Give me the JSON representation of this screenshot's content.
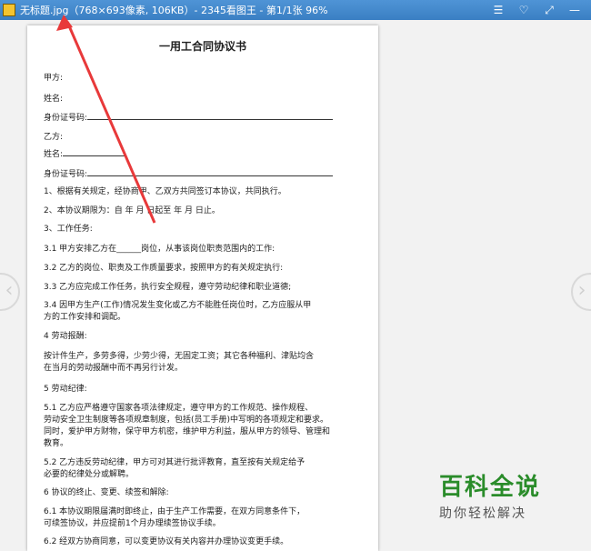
{
  "titlebar": {
    "title": "无标题.jpg（768×693像素, 106KB）- 2345看图王 - 第1/1张 96%",
    "icons": [
      "menu-icon",
      "skin-icon",
      "fullscreen-icon",
      "minimize-icon"
    ]
  },
  "document": {
    "title": "一用工合同协议书",
    "lines": [
      "甲方:",
      "姓名:",
      "身份证号码:",
      "乙方:",
      "姓名:",
      "身份证号码:",
      "1、根据有关规定，经协商甲、乙双方共同签订本协议，共同执行。",
      "2、本协议期限为：自        年     月     日起至        年     月     日止。",
      "3、工作任务:",
      "3.1 甲方安排乙方在______岗位，从事该岗位职责范围内的工作:",
      "3.2 乙方的岗位、职责及工作质量要求，按照甲方的有关规定执行:",
      "3.3 乙方应完成工作任务，执行安全规程，遵守劳动纪律和职业道德;",
      "3.4 因甲方生产(工作)情况发生变化或乙方不能胜任岗位时，乙方应服从甲",
      "方的工作安排和调配。",
      "4 劳动报酬:",
      "按计件生产，多劳多得，少劳少得，无固定工资；其它各种福利、津贴均含",
      "在当月的劳动报酬中而不再另行计发。",
      "5 劳动纪律:",
      "5.1 乙方应严格遵守国家各项法律规定，遵守甲方的工作规范、操作规程、",
      "劳动安全卫生制度等各项规章制度，包括(员工手册)中写明的各项规定和要求。",
      "同时，爱护甲方财物，保守甲方机密，维护甲方利益，服从甲方的领导、管理和",
      "教育。",
      "5.2 乙方违反劳动纪律，甲方可对其进行批评教育，直至按有关规定给予",
      "必要的纪律处分或解聘。",
      "6 协议的终止、变更、续签和解除:",
      "6.1 本协议期限届满时即终止，由于生产工作需要，在双方同意条件下，",
      "可续签协议，并应提前1个月办理续签协议手续。",
      "6.2 经双方协商同意，可以变更协议有关内容并办理协议变更手续。"
    ]
  },
  "watermark": {
    "main": "百科全说",
    "sub": "助你轻松解决"
  },
  "colors": {
    "titlebar": "#3a7fc3",
    "arrow": "#e8393a",
    "watermark": "#2a8c2a"
  }
}
